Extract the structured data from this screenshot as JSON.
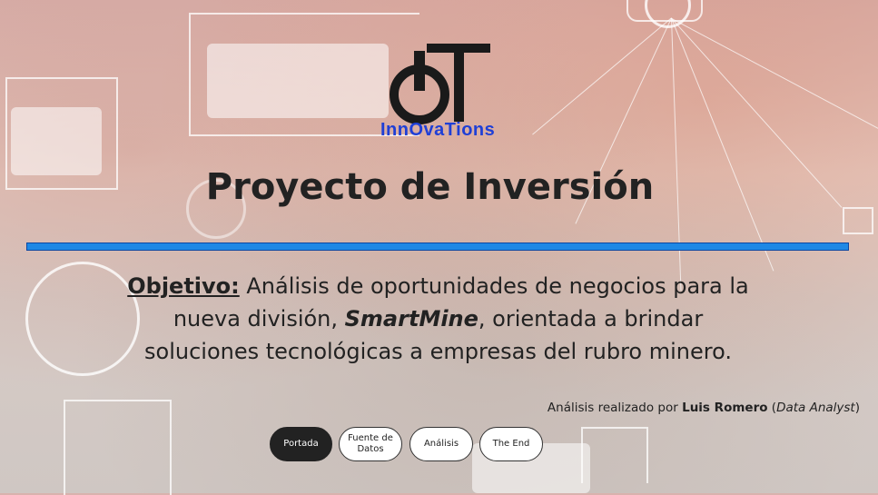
{
  "logo": {
    "mark": "IT",
    "text": "InnOvaTions",
    "brand_dark": "#1a1a1a",
    "brand_blue": "#1f3fd6"
  },
  "title": "Proyecto de Inversión",
  "objective": {
    "label": "Objetivo:",
    "part1": " Análisis de oportunidades de negocios para la nueva división, ",
    "brand": "SmartMine",
    "part2": ", orientada a brindar soluciones tecnológicas a empresas del rubro minero."
  },
  "credit": {
    "prefix": "Análisis realizado por ",
    "author": "Luis Romero",
    "role_open": " (",
    "role": "Data Analyst",
    "role_close": ")"
  },
  "nav": [
    {
      "label": "Portada",
      "active": true
    },
    {
      "label": "Fuente de Datos",
      "active": false
    },
    {
      "label": "Análisis",
      "active": false
    },
    {
      "label": "The End",
      "active": false
    }
  ],
  "colors": {
    "accent_bar": "#1e88e5",
    "active_button": "#222222"
  }
}
